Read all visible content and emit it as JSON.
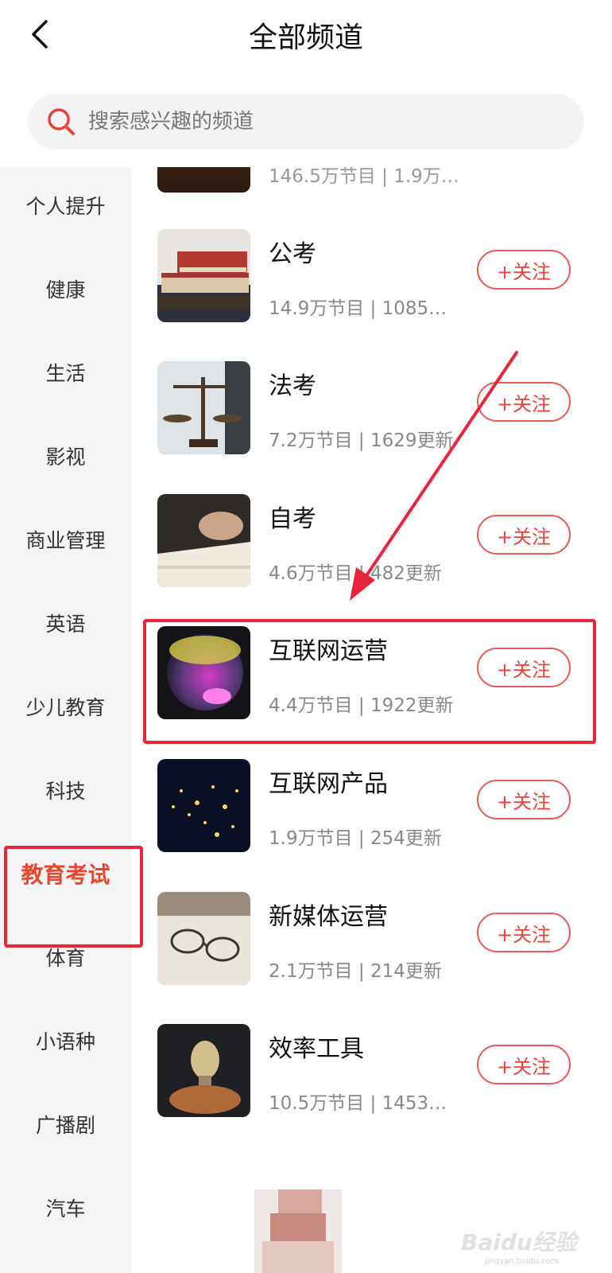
{
  "header": {
    "title": "全部频道"
  },
  "search": {
    "placeholder": "搜索感兴趣的频道"
  },
  "sidebar": {
    "items": [
      {
        "label": "个人提升"
      },
      {
        "label": "健康"
      },
      {
        "label": "生活"
      },
      {
        "label": "影视"
      },
      {
        "label": "商业管理"
      },
      {
        "label": "英语"
      },
      {
        "label": "少儿教育"
      },
      {
        "label": "科技"
      },
      {
        "label": "教育考试",
        "active": true
      },
      {
        "label": "体育"
      },
      {
        "label": "小语种"
      },
      {
        "label": "广播剧"
      },
      {
        "label": "汽车"
      }
    ]
  },
  "channels": [
    {
      "title": "",
      "meta": "146.5万节目 | 1.9万…",
      "partial": true
    },
    {
      "title": "公考",
      "meta": "14.9万节目 | 1085…",
      "follow": "+关注"
    },
    {
      "title": "法考",
      "meta": "7.2万节目 | 1629更新",
      "follow": "+关注"
    },
    {
      "title": "自考",
      "meta": "4.6万节目 | 482更新",
      "follow": "+关注"
    },
    {
      "title": "互联网运营",
      "meta": "4.4万节目 | 1922更新",
      "follow": "+关注",
      "highlighted": true
    },
    {
      "title": "互联网产品",
      "meta": "1.9万节目 | 254更新",
      "follow": "+关注"
    },
    {
      "title": "新媒体运营",
      "meta": "2.1万节目 | 214更新",
      "follow": "+关注"
    },
    {
      "title": "效率工具",
      "meta": "10.5万节目 | 1453…",
      "follow": "+关注"
    }
  ],
  "watermark": {
    "brand": "Baidu经验",
    "url": "jingyan.baidu.com"
  },
  "colors": {
    "accent": "#e8472d",
    "annotation": "#e8253b",
    "sidebar_bg": "#f4f4f6"
  }
}
